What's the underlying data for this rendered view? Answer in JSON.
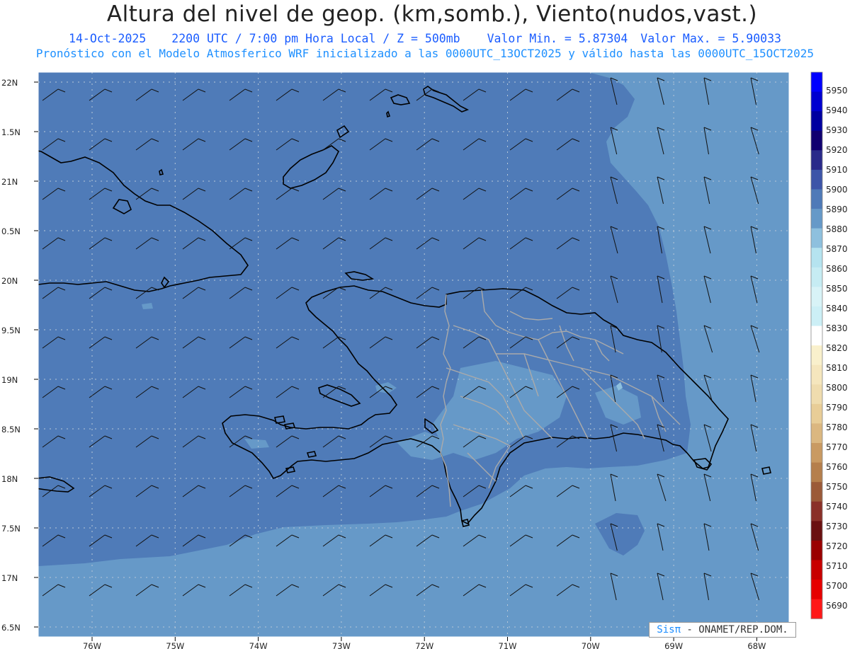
{
  "header": {
    "title": "Altura del nivel de geop. (km,somb.), Viento(nudos,vast.)",
    "date": "14-Oct-2025",
    "time": "2200 UTC / 7:00 pm Hora Local / Z = 500mb",
    "min": "Valor Min. = 5.87304",
    "max": "Valor Max. = 5.90033",
    "model_line": "Pronóstico con el Modelo Atmosferico WRF inicializado a las 0000UTC_13OCT2025 y válido hasta las  0000UTC_15OCT2025"
  },
  "axes": {
    "lat_labels": [
      "22N",
      "1.5N",
      "21N",
      "0.5N",
      "20N",
      "9.5N",
      "19N",
      "8.5N",
      "18N",
      "7.5N",
      "17N",
      "6.5N"
    ],
    "lon_labels": [
      "76W",
      "75W",
      "74W",
      "73W",
      "72W",
      "71W",
      "70W",
      "69W",
      "68W"
    ]
  },
  "colorbar": {
    "labels": [
      "5950",
      "5940",
      "5930",
      "5920",
      "5910",
      "5900",
      "5890",
      "5880",
      "5870",
      "5860",
      "5850",
      "5840",
      "5830",
      "5820",
      "5810",
      "5800",
      "5790",
      "5780",
      "5770",
      "5760",
      "5750",
      "5740",
      "5730",
      "5720",
      "5710",
      "5700",
      "5690"
    ],
    "colors": [
      "#0000ff",
      "#0000d0",
      "#0000a0",
      "#100070",
      "#2a2a8a",
      "#3d55a8",
      "#4f7ab8",
      "#6699c8",
      "#8ec0de",
      "#b5e3ef",
      "#c6ecf3",
      "#d8f3f7",
      "#cceff6",
      "#ffffff",
      "#f9f0cc",
      "#f5e6bd",
      "#efdcae",
      "#e8cd97",
      "#dbb780",
      "#c99a62",
      "#b57f4c",
      "#9b5a38",
      "#8a3028",
      "#6a1010",
      "#9a0000",
      "#c80000",
      "#e60000",
      "#ff1818"
    ]
  },
  "credit": {
    "brand": "Sisπ",
    "text": " - ONAMET/REP.DOM."
  }
}
